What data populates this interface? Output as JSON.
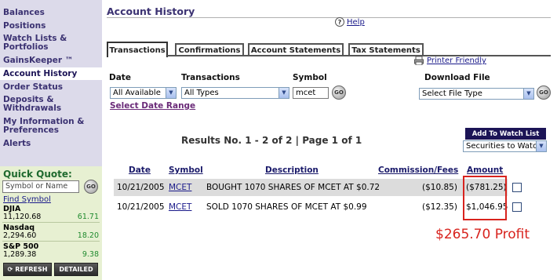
{
  "sidebar": {
    "items": [
      {
        "label": "Balances"
      },
      {
        "label": "Positions"
      },
      {
        "label": "Watch Lists &",
        "label2": "Portfolios"
      },
      {
        "label": "GainsKeeper ™"
      },
      {
        "label": "Account History"
      },
      {
        "label": "Order Status"
      },
      {
        "label": "Deposits &",
        "label2": "Withdrawals"
      },
      {
        "label": "My Information &",
        "label2": "Preferences"
      },
      {
        "label": "Alerts"
      }
    ],
    "active_index": 4
  },
  "quick_quote": {
    "title": "Quick Quote:",
    "input_placeholder": "Symbol or Name",
    "go_label": "GO",
    "find_symbol": "Find Symbol",
    "indices": [
      {
        "name": "DJIA",
        "value": "11,120.68",
        "change": "61.71"
      },
      {
        "name": "Nasdaq",
        "value": "2,294.60",
        "change": "18.20"
      },
      {
        "name": "S&P 500",
        "value": "1,289.38",
        "change": "9.38"
      }
    ],
    "refresh_label": "REFRESH",
    "detailed_label": "DETAILED"
  },
  "main": {
    "title": "Account History",
    "help": "Help",
    "tabs": [
      {
        "label": "Transactions",
        "active": true
      },
      {
        "label": "Confirmations",
        "active": false
      },
      {
        "label": "Account Statements",
        "active": false
      },
      {
        "label": "Tax Statements",
        "active": false
      }
    ],
    "printer_friendly": "Printer Friendly",
    "filters": {
      "date_label": "Date",
      "date_value": "All Available",
      "transactions_label": "Transactions",
      "transactions_value": "All Types",
      "symbol_label": "Symbol",
      "symbol_value": "mcet",
      "go_label": "GO",
      "download_label": "Download File",
      "download_value": "Select File Type",
      "date_range_link": "Select Date Range"
    },
    "results_text": "Results No. 1 - 2 of 2 | Page 1 of 1",
    "add_watch_list": "Add To Watch List",
    "watch_select": "Securities to Watc",
    "table": {
      "headers": [
        "Date",
        "Symbol",
        "Description",
        "Commission/Fees",
        "Amount"
      ],
      "rows": [
        {
          "date": "10/21/2005",
          "symbol": "MCET",
          "description": "BOUGHT 1070 SHARES OF MCET AT $0.72",
          "fees": "($10.85)",
          "amount": "($781.25)"
        },
        {
          "date": "10/21/2005",
          "symbol": "MCET",
          "description": "SOLD 1070 SHARES OF MCET AT $0.99",
          "fees": "($12.35)",
          "amount": "$1,046.95"
        }
      ]
    },
    "annotation": "$265.70 Profit",
    "colors": {
      "accent": "#3b3272",
      "highlight": "#d8231e",
      "row_shade": "#dcdcdc"
    }
  }
}
